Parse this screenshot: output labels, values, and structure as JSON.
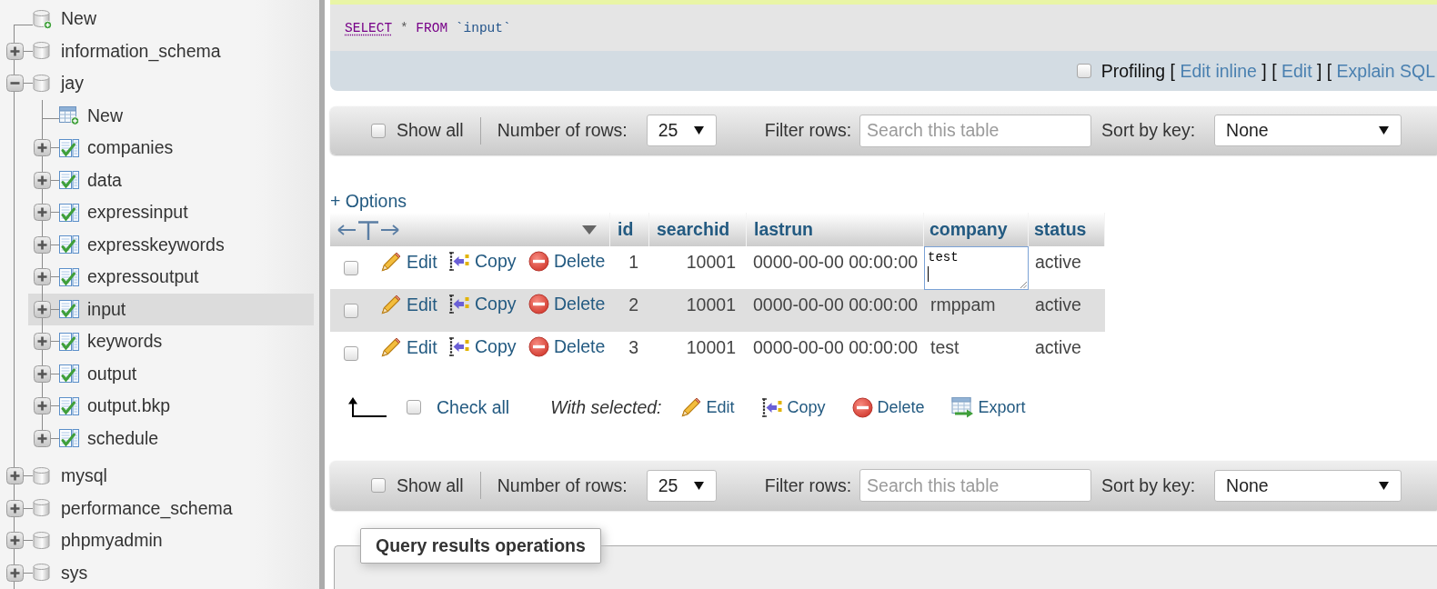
{
  "sidebar": {
    "tree": [
      {
        "kind": "new-database",
        "label": "New",
        "selected": false
      },
      {
        "kind": "database",
        "label": "information_schema",
        "expanded": false,
        "selected": false
      },
      {
        "kind": "database",
        "label": "jay",
        "expanded": true,
        "selected": false,
        "children": [
          {
            "kind": "new-table",
            "label": "New",
            "selected": false
          },
          {
            "kind": "table",
            "label": "companies",
            "expanded": false,
            "selected": false
          },
          {
            "kind": "table",
            "label": "data",
            "expanded": false,
            "selected": false
          },
          {
            "kind": "table",
            "label": "expressinput",
            "expanded": false,
            "selected": false
          },
          {
            "kind": "table",
            "label": "expresskeywords",
            "expanded": false,
            "selected": false
          },
          {
            "kind": "table",
            "label": "expressoutput",
            "expanded": false,
            "selected": false
          },
          {
            "kind": "table",
            "label": "input",
            "expanded": false,
            "selected": true
          },
          {
            "kind": "table",
            "label": "keywords",
            "expanded": false,
            "selected": false
          },
          {
            "kind": "table",
            "label": "output",
            "expanded": false,
            "selected": false
          },
          {
            "kind": "table",
            "label": "output.bkp",
            "expanded": false,
            "selected": false
          },
          {
            "kind": "table",
            "label": "schedule",
            "expanded": false,
            "selected": false
          }
        ]
      },
      {
        "kind": "database",
        "label": "mysql",
        "expanded": false,
        "selected": false
      },
      {
        "kind": "database",
        "label": "performance_schema",
        "expanded": false,
        "selected": false
      },
      {
        "kind": "database",
        "label": "phpmyadmin",
        "expanded": false,
        "selected": false
      },
      {
        "kind": "database",
        "label": "sys",
        "expanded": false,
        "selected": false
      }
    ]
  },
  "query": {
    "sql": [
      {
        "kind": "keyword-link",
        "text": "SELECT"
      },
      {
        "kind": "operator",
        "text": "*"
      },
      {
        "kind": "keyword",
        "text": "FROM"
      },
      {
        "kind": "identifier",
        "text": "`input`"
      }
    ],
    "profiling": {
      "label": "Profiling",
      "checked": false
    },
    "links": [
      {
        "open": "[",
        "label": "Edit inline",
        "close": "]"
      },
      {
        "open": "[",
        "label": "Edit",
        "close": "]"
      },
      {
        "open": "[",
        "label": "Explain SQL"
      }
    ]
  },
  "top_navigation": {
    "show_all": {
      "label": "Show all",
      "checked": false
    },
    "rows": {
      "label": "Number of rows:",
      "value": "25"
    },
    "filter": {
      "label": "Filter rows:",
      "placeholder": "Search this table"
    },
    "sort": {
      "label": "Sort by key:",
      "value": "None"
    }
  },
  "results": {
    "options_link": "+ Options",
    "columns": [
      {
        "label": "id",
        "kind": "number"
      },
      {
        "label": "searchid",
        "kind": "number"
      },
      {
        "label": "lastrun",
        "kind": "text"
      },
      {
        "label": "company",
        "kind": "text"
      },
      {
        "label": "status",
        "kind": "text"
      }
    ],
    "rows": [
      {
        "checked": false,
        "actions": [
          {
            "kind": "edit",
            "label": "Edit"
          },
          {
            "kind": "copy",
            "label": "Copy"
          },
          {
            "kind": "delete",
            "label": "Delete"
          }
        ],
        "cells": [
          {
            "text": "1",
            "editing": false
          },
          {
            "text": "10001",
            "editing": false
          },
          {
            "text": "0000-00-00 00:00:00",
            "editing": false
          },
          {
            "text": "test",
            "editing": true
          },
          {
            "text": "active",
            "editing": false
          }
        ]
      },
      {
        "checked": false,
        "actions": [
          {
            "kind": "edit",
            "label": "Edit"
          },
          {
            "kind": "copy",
            "label": "Copy"
          },
          {
            "kind": "delete",
            "label": "Delete"
          }
        ],
        "cells": [
          {
            "text": "2",
            "editing": false
          },
          {
            "text": "10001",
            "editing": false
          },
          {
            "text": "0000-00-00 00:00:00",
            "editing": false
          },
          {
            "text": "rmppam",
            "editing": false
          },
          {
            "text": "active",
            "editing": false
          }
        ]
      },
      {
        "checked": false,
        "actions": [
          {
            "kind": "edit",
            "label": "Edit"
          },
          {
            "kind": "copy",
            "label": "Copy"
          },
          {
            "kind": "delete",
            "label": "Delete"
          }
        ],
        "cells": [
          {
            "text": "3",
            "editing": false
          },
          {
            "text": "10001",
            "editing": false
          },
          {
            "text": "0000-00-00 00:00:00",
            "editing": false
          },
          {
            "text": "test",
            "editing": false
          },
          {
            "text": "active",
            "editing": false
          }
        ]
      }
    ]
  },
  "bulk_actions": {
    "check_all": {
      "label": "Check all",
      "checked": false
    },
    "with_selected": "With selected:",
    "actions": [
      {
        "kind": "edit",
        "label": "Edit"
      },
      {
        "kind": "copy",
        "label": "Copy"
      },
      {
        "kind": "delete",
        "label": "Delete"
      },
      {
        "kind": "export",
        "label": "Export"
      }
    ]
  },
  "bottom_navigation": {
    "show_all": {
      "label": "Show all",
      "checked": false
    },
    "rows": {
      "label": "Number of rows:",
      "value": "25"
    },
    "filter": {
      "label": "Filter rows:",
      "placeholder": "Search this table"
    },
    "sort": {
      "label": "Sort by key:",
      "value": "None"
    }
  },
  "operations": {
    "legend": "Query results operations"
  }
}
